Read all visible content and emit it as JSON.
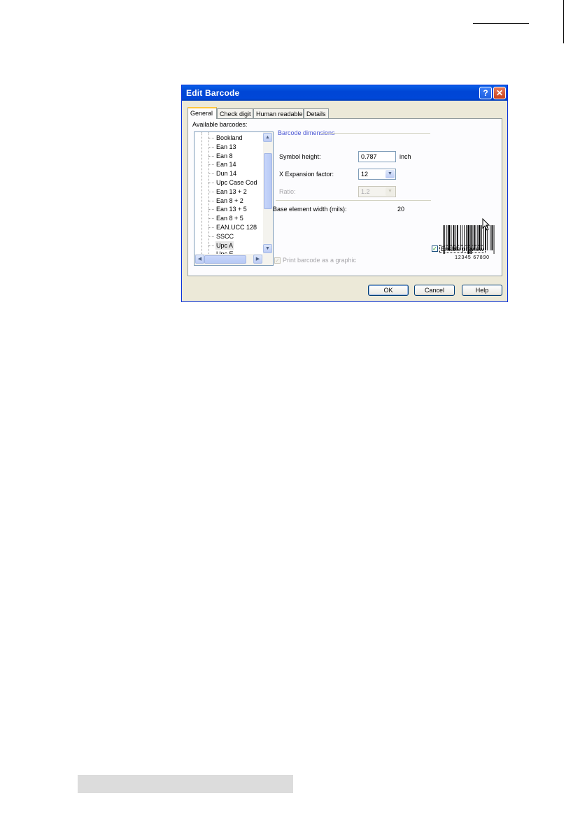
{
  "dialog": {
    "title": "Edit Barcode",
    "help_button": "?",
    "close_button": "✕"
  },
  "tabs": [
    "General",
    "Check digit",
    "Human readable",
    "Details"
  ],
  "active_tab": "General",
  "available_barcodes": {
    "label": "Available barcodes:",
    "items": [
      "Bookland",
      "Ean 13",
      "Ean 8",
      "Ean 14",
      "Dun 14",
      "Upc Case Cod",
      "Ean 13 + 2",
      "Ean 8 + 2",
      "Ean 13 + 5",
      "Ean 8 + 5",
      "EAN.UCC 128",
      "SSCC",
      "Upc A",
      "Upc E"
    ],
    "selected": "Upc A"
  },
  "dimensions": {
    "group_title": "Barcode dimensions",
    "symbol_height_label": "Symbol height:",
    "symbol_height_value": "0.787",
    "symbol_height_unit": "inch",
    "x_expansion_label": "X Expansion factor:",
    "x_expansion_value": "12",
    "ratio_label": "Ratio:",
    "ratio_value": "1.2",
    "base_width_label": "Base element width (mils):",
    "base_width_value": "20"
  },
  "preview": {
    "digits": "12345 67890",
    "enable_label": "Enable preview",
    "enable_checked": true
  },
  "print_graphic": {
    "label": "Print barcode as a graphic",
    "checked": true,
    "enabled": false
  },
  "buttons": {
    "ok": "OK",
    "cancel": "Cancel",
    "help": "Help"
  },
  "icons": {
    "scroll_up": "▲",
    "scroll_down": "▼",
    "scroll_left": "◀",
    "scroll_right": "▶",
    "dropdown": "▼",
    "check": "✓"
  }
}
